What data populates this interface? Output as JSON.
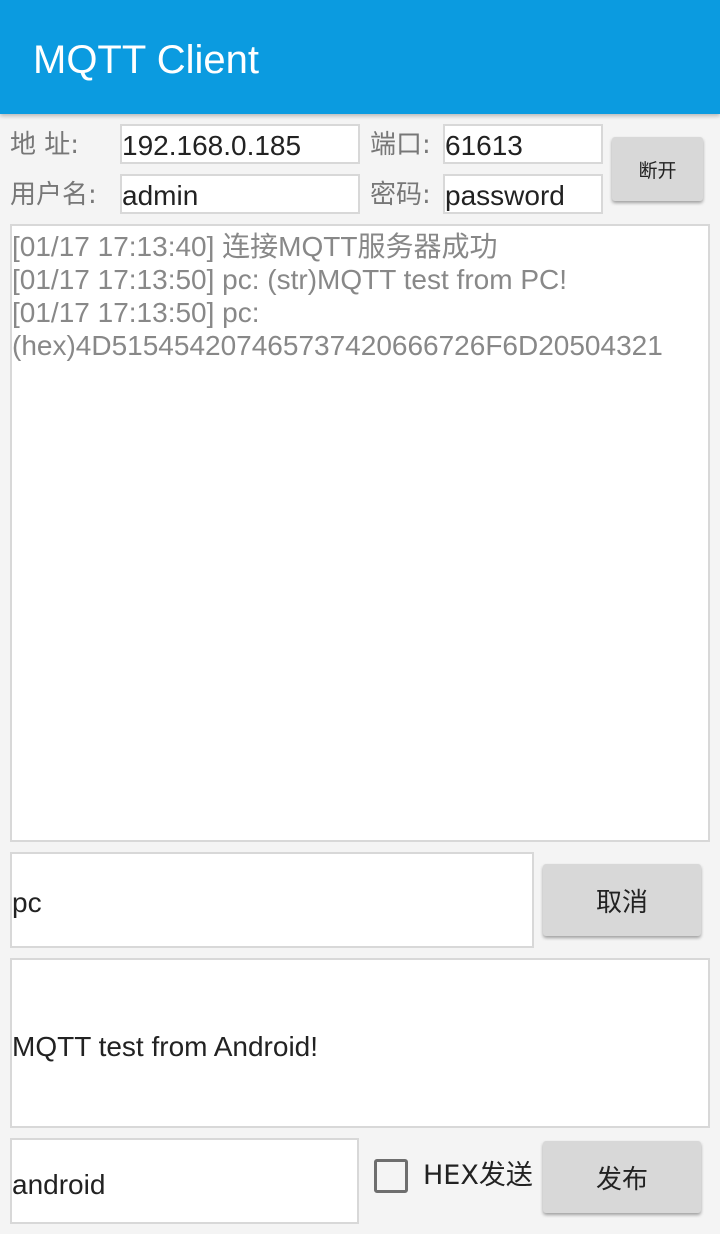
{
  "app": {
    "title": "MQTT Client"
  },
  "connection": {
    "address_label": "地    址:",
    "address_value": "192.168.0.185",
    "port_label": "端口:",
    "port_value": "61613",
    "username_label": "用户名:",
    "username_value": "admin",
    "password_label": "密码:",
    "password_value": "password",
    "disconnect_label": "断开"
  },
  "log": {
    "lines": [
      "[01/17 17:13:40] 连接MQTT服务器成功",
      "[01/17 17:13:50] pc: (str)MQTT test from PC!",
      "[01/17 17:13:50] pc:",
      "(hex)4D515454207465737420666726F6D20504321"
    ]
  },
  "subscribe": {
    "topic_value": "pc",
    "cancel_label": "取消"
  },
  "publish": {
    "message_value": "MQTT test from Android!",
    "topic_value": "android",
    "hex_label": "HEX发送",
    "hex_checked": false,
    "publish_label": "发布"
  },
  "colors": {
    "appbar": "#0b9be0",
    "background": "#f4f4f4",
    "button": "#d8d8d8",
    "log_text": "#888888"
  }
}
